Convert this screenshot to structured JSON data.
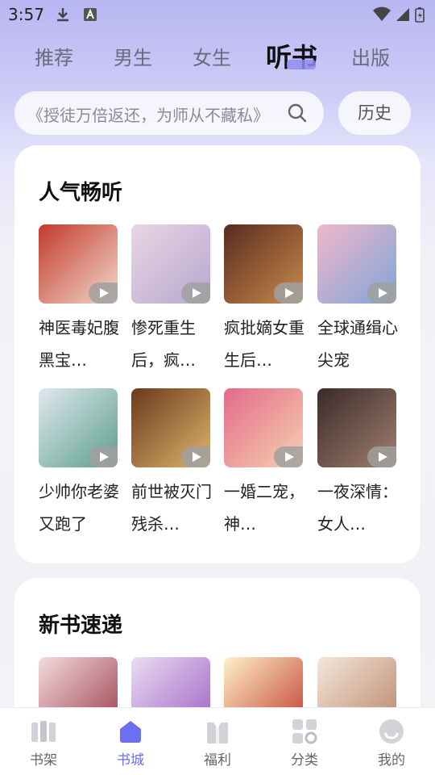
{
  "status_bar": {
    "time": "3:57"
  },
  "top_tabs": [
    {
      "label": "推荐"
    },
    {
      "label": "男生"
    },
    {
      "label": "女生"
    },
    {
      "label": "听书",
      "active": true
    },
    {
      "label": "出版"
    }
  ],
  "search": {
    "placeholder": "《授徒万倍返还，为师从不藏私》"
  },
  "history_label": "历史",
  "sections": {
    "hot": {
      "title": "人气畅听",
      "books": [
        {
          "title": "神医毒妃腹黑宝…",
          "cover_colors": [
            "#c23a2e",
            "#f2d9c9"
          ]
        },
        {
          "title": "惨死重生后，疯…",
          "cover_colors": [
            "#e9d6e4",
            "#b8a6cf"
          ]
        },
        {
          "title": "疯批嫡女重生后…",
          "cover_colors": [
            "#5a2a22",
            "#c88c4a"
          ]
        },
        {
          "title": "全球通缉心尖宠",
          "cover_colors": [
            "#f0b7c8",
            "#7fa6d8"
          ]
        },
        {
          "title": "少帅你老婆又跑了",
          "cover_colors": [
            "#dfe8ef",
            "#5c9e8a"
          ]
        },
        {
          "title": "前世被灭门残杀…",
          "cover_colors": [
            "#6b3a1e",
            "#e0b56a"
          ]
        },
        {
          "title": "一婚二宠，神…",
          "cover_colors": [
            "#e36a8a",
            "#f6d2b0"
          ]
        },
        {
          "title": "一夜深情：女人…",
          "cover_colors": [
            "#3b2a28",
            "#a08070"
          ]
        }
      ]
    },
    "new": {
      "title": "新书速递",
      "books": [
        {
          "cover_colors": [
            "#f3dcdc",
            "#9a3a4a"
          ]
        },
        {
          "cover_colors": [
            "#eadcf2",
            "#9d5fc4"
          ]
        },
        {
          "cover_colors": [
            "#fff1c9",
            "#c0392b"
          ]
        },
        {
          "cover_colors": [
            "#f4e6da",
            "#b88466"
          ]
        }
      ]
    }
  },
  "bottom_nav": [
    {
      "label": "书架",
      "icon": "bookshelf-icon"
    },
    {
      "label": "书城",
      "icon": "bookstore-icon",
      "active": true
    },
    {
      "label": "福利",
      "icon": "gift-icon"
    },
    {
      "label": "分类",
      "icon": "category-icon"
    },
    {
      "label": "我的",
      "icon": "profile-icon"
    }
  ],
  "colors": {
    "accent": "#6b6ff0",
    "tab_underline": "#8f8df0"
  }
}
